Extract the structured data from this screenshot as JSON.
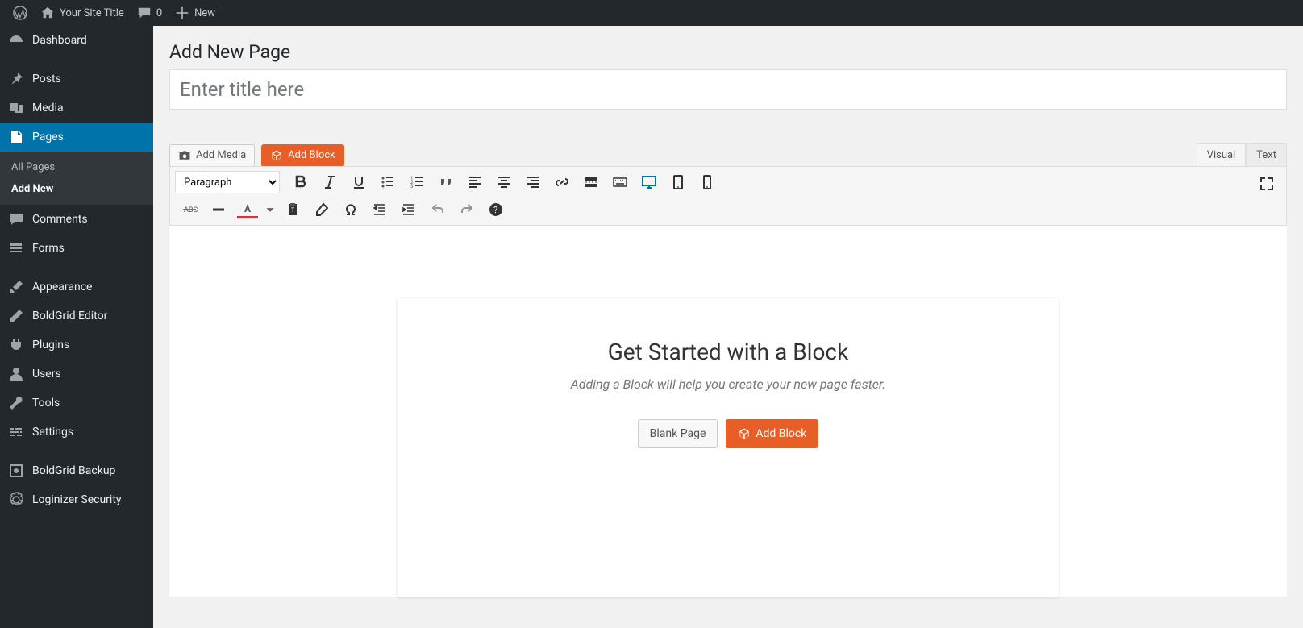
{
  "topbar": {
    "site_title": "Your Site Title",
    "comments_count": "0",
    "new_label": "New"
  },
  "sidebar": {
    "items": [
      {
        "label": "Dashboard"
      },
      {
        "label": "Posts"
      },
      {
        "label": "Media"
      },
      {
        "label": "Pages",
        "active": true
      },
      {
        "label": "Comments"
      },
      {
        "label": "Forms"
      },
      {
        "label": "Appearance"
      },
      {
        "label": "BoldGrid Editor"
      },
      {
        "label": "Plugins"
      },
      {
        "label": "Users"
      },
      {
        "label": "Tools"
      },
      {
        "label": "Settings"
      },
      {
        "label": "BoldGrid Backup"
      },
      {
        "label": "Loginizer Security"
      }
    ],
    "submenu": {
      "all_pages": "All Pages",
      "add_new": "Add New"
    }
  },
  "main": {
    "heading": "Add New Page",
    "title_placeholder": "Enter title here",
    "add_media": "Add Media",
    "add_block": "Add Block",
    "tabs": {
      "visual": "Visual",
      "text": "Text"
    },
    "format_select": "Paragraph"
  },
  "starter": {
    "title": "Get Started with a Block",
    "subtitle": "Adding a Block will help you create your new page faster.",
    "blank_page": "Blank Page",
    "add_block": "Add Block"
  }
}
